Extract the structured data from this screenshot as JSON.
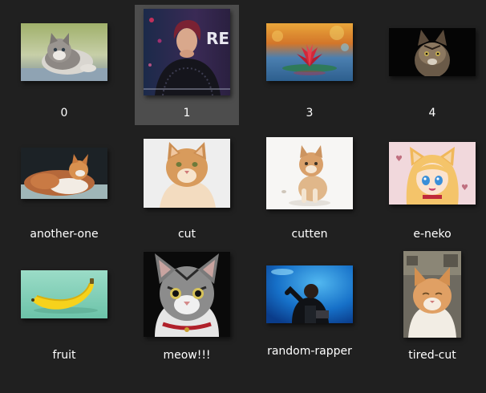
{
  "window": {
    "view": "large-icons",
    "background": "#202020",
    "selected_index": 1
  },
  "items": [
    {
      "label": "0",
      "kind": "kitten-grey-white"
    },
    {
      "label": "1",
      "kind": "woman-portrait"
    },
    {
      "label": "3",
      "kind": "water-lotus"
    },
    {
      "label": "4",
      "kind": "tabby-black-bg"
    },
    {
      "label": "another-one",
      "kind": "cat-lying"
    },
    {
      "label": "cut",
      "kind": "orange-cat-portrait"
    },
    {
      "label": "cutten",
      "kind": "kitten-white-bg"
    },
    {
      "label": "e-neko",
      "kind": "anime-catgirl"
    },
    {
      "label": "fruit",
      "kind": "banana"
    },
    {
      "label": "meow!!!",
      "kind": "tabby-red-collar"
    },
    {
      "label": "random-rapper",
      "kind": "rapper-blue-stage"
    },
    {
      "label": "tired-cut",
      "kind": "tired-orange-cat"
    }
  ]
}
